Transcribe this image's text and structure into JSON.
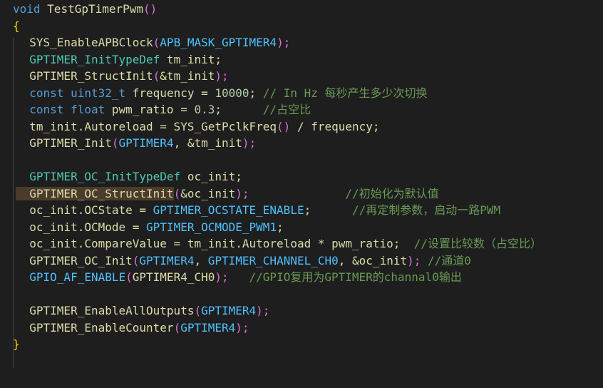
{
  "code_lines": [
    [
      {
        "t": "void",
        "c": "kw"
      },
      {
        "t": " ",
        "c": "plain"
      },
      {
        "t": "TestGpTimerPwm",
        "c": "fn"
      },
      {
        "t": "()",
        "c": "paren"
      }
    ],
    [
      {
        "t": "{",
        "c": "brace"
      }
    ],
    [
      {
        "t": "  SYS_EnableAPBClock",
        "c": "fn"
      },
      {
        "t": "(",
        "c": "paren"
      },
      {
        "t": "APB_MASK_GPTIMER4",
        "c": "const"
      },
      {
        "t": ");",
        "c": "paren"
      }
    ],
    [
      {
        "t": "  GPTIMER_InitTypeDef",
        "c": "ty"
      },
      {
        "t": " tm_init;",
        "c": "plain"
      }
    ],
    [
      {
        "t": "  GPTIMER_StructInit",
        "c": "fn"
      },
      {
        "t": "(",
        "c": "paren"
      },
      {
        "t": "&tm_init",
        "c": "plain"
      },
      {
        "t": ");",
        "c": "paren"
      }
    ],
    [
      {
        "t": "  const",
        "c": "kw"
      },
      {
        "t": " uint32_t",
        "c": "kw"
      },
      {
        "t": " frequency = ",
        "c": "plain"
      },
      {
        "t": "10000",
        "c": "num"
      },
      {
        "t": "; ",
        "c": "plain"
      },
      {
        "t": "// In Hz 每秒产生多少次切换",
        "c": "com"
      }
    ],
    [
      {
        "t": "  const",
        "c": "kw"
      },
      {
        "t": " float",
        "c": "kw"
      },
      {
        "t": " pwm_ratio = ",
        "c": "plain"
      },
      {
        "t": "0.3",
        "c": "num"
      },
      {
        "t": ";      ",
        "c": "plain"
      },
      {
        "t": "//占空比",
        "c": "com"
      }
    ],
    [
      {
        "t": "  tm_init.Autoreload = SYS_GetPclkFreq",
        "c": "plain"
      },
      {
        "t": "()",
        "c": "paren"
      },
      {
        "t": " / frequency;",
        "c": "plain"
      }
    ],
    [
      {
        "t": "  GPTIMER_Init",
        "c": "fn"
      },
      {
        "t": "(",
        "c": "paren"
      },
      {
        "t": "GPTIMER4",
        "c": "const"
      },
      {
        "t": ", &tm_init",
        "c": "plain"
      },
      {
        "t": ");",
        "c": "paren"
      }
    ],
    [],
    [
      {
        "t": "  GPTIMER_OC_InitTypeDef",
        "c": "ty"
      },
      {
        "t": " oc_init;",
        "c": "plain"
      }
    ],
    [
      {
        "t": "  GPTIMER_OC_StructInit",
        "c": "fn",
        "hl": true
      },
      {
        "t": "(",
        "c": "paren"
      },
      {
        "t": "&oc_init",
        "c": "plain"
      },
      {
        "t": ");",
        "c": "paren"
      },
      {
        "t": "              ",
        "c": "plain"
      },
      {
        "t": "//初始化为默认值",
        "c": "com"
      }
    ],
    [
      {
        "t": "  oc_init.OCState = ",
        "c": "plain"
      },
      {
        "t": "GPTIMER_OCSTATE_ENABLE",
        "c": "const"
      },
      {
        "t": ";      ",
        "c": "plain"
      },
      {
        "t": "//再定制参数，启动一路PWM",
        "c": "com"
      }
    ],
    [
      {
        "t": "  oc_init.OCMode = ",
        "c": "plain"
      },
      {
        "t": "GPTIMER_OCMODE_PWM1",
        "c": "const"
      },
      {
        "t": ";",
        "c": "plain"
      }
    ],
    [
      {
        "t": "  oc_init.CompareValue = tm_init.Autoreload * pwm_ratio;  ",
        "c": "plain"
      },
      {
        "t": "//设置比较数（占空比）",
        "c": "com"
      }
    ],
    [
      {
        "t": "  GPTIMER_OC_Init",
        "c": "fn"
      },
      {
        "t": "(",
        "c": "paren"
      },
      {
        "t": "GPTIMER4",
        "c": "const"
      },
      {
        "t": ", ",
        "c": "plain"
      },
      {
        "t": "GPTIMER_CHANNEL_CH0",
        "c": "const"
      },
      {
        "t": ", &oc_init",
        "c": "plain"
      },
      {
        "t": ");",
        "c": "paren"
      },
      {
        "t": " ",
        "c": "plain"
      },
      {
        "t": "//通道0",
        "c": "com"
      }
    ],
    [
      {
        "t": "  GPIO_AF_ENABLE",
        "c": "const"
      },
      {
        "t": "(",
        "c": "paren"
      },
      {
        "t": "GPTIMER4_CH0",
        "c": "plain"
      },
      {
        "t": ");",
        "c": "paren"
      },
      {
        "t": "   ",
        "c": "plain"
      },
      {
        "t": "//GPIO复用为GPTIMER的channal0输出",
        "c": "com"
      }
    ],
    [],
    [
      {
        "t": "  GPTIMER_EnableAllOutputs",
        "c": "fn"
      },
      {
        "t": "(",
        "c": "paren"
      },
      {
        "t": "GPTIMER4",
        "c": "const"
      },
      {
        "t": ");",
        "c": "paren"
      }
    ],
    [
      {
        "t": "  GPTIMER_EnableCounter",
        "c": "fn"
      },
      {
        "t": "(",
        "c": "paren"
      },
      {
        "t": "GPTIMER4",
        "c": "const"
      },
      {
        "t": ");",
        "c": "paren"
      }
    ],
    [
      {
        "t": "}",
        "c": "brace"
      }
    ]
  ],
  "colors": {
    "background": "#1e1e1e",
    "keyword": "#569cd6",
    "function": "#dcdcaa",
    "type": "#4ec9b0",
    "constant": "#4fc1ff",
    "number": "#b5cea8",
    "comment": "#6a9955",
    "brace": "#ffd700",
    "paren": "#da70d6",
    "highlight": "#4a3c2a"
  }
}
